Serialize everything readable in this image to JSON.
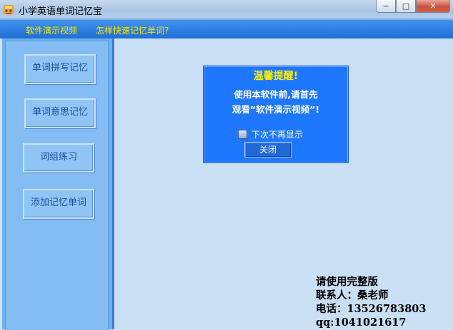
{
  "window": {
    "title": "小学英语单词记忆宝",
    "minimize": "−",
    "maximize": "□",
    "close": "✕"
  },
  "menu": {
    "items": [
      "软件演示视频",
      "怎样快速记忆单词?"
    ]
  },
  "sidebar": {
    "buttons": [
      "单词拼写记忆",
      "单词意思记忆",
      "词组练习",
      "添加记忆单词"
    ]
  },
  "dialog": {
    "title": "温馨提醒!",
    "message_line1": "使用本软件前,请首先",
    "message_line2": "观看“软件演示视频”!",
    "checkbox_label": "下次不再显示",
    "close_button": "关闭"
  },
  "contact": {
    "line1": "请使用完整版",
    "line2": "联系人：桑老师",
    "line3": "电话：13526783803",
    "line4": "qq:1041021617"
  }
}
